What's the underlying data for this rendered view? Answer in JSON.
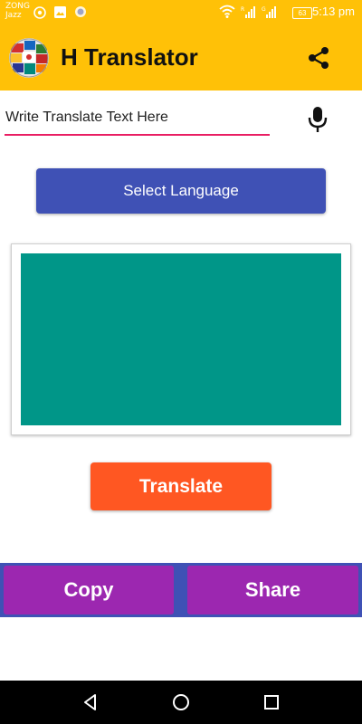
{
  "status_bar": {
    "carrier_line1": "ZONG",
    "carrier_line2": "Jazz",
    "battery": "63",
    "time": "5:13 pm",
    "icons": [
      "whatsapp-icon",
      "image-icon",
      "circle-icon",
      "wifi-icon",
      "signal-icon",
      "signal-icon",
      "battery-icon"
    ]
  },
  "app_bar": {
    "title": "H Translator",
    "logo_icon": "flags-globe-icon",
    "share_icon": "share-icon",
    "background": "#FFC107"
  },
  "input": {
    "placeholder": "Write Translate Text Here",
    "value": "",
    "underline_color": "#E91E63",
    "mic_icon": "mic-icon"
  },
  "select_language": {
    "label": "Select Language",
    "color": "#3F51B5"
  },
  "output": {
    "text": "",
    "color": "#009688"
  },
  "translate": {
    "label": "Translate",
    "color": "#FF5722"
  },
  "bottom_actions": {
    "copy_label": "Copy",
    "share_label": "Share",
    "button_color": "#9C27B0",
    "bar_color": "#3F51B5"
  },
  "nav_bar": {
    "icons": [
      "back-icon",
      "home-icon",
      "recents-icon"
    ]
  }
}
